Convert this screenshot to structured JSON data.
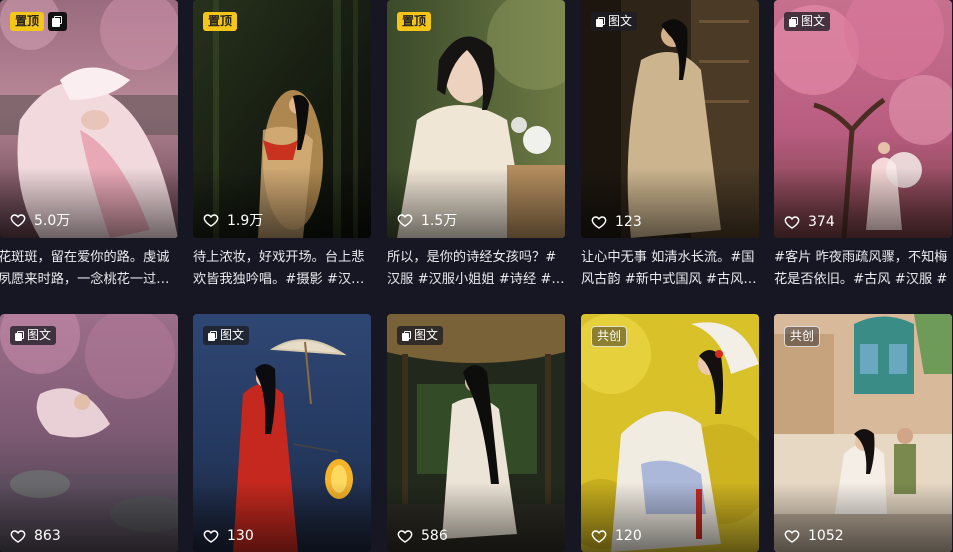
{
  "cards": [
    {
      "badge": "置顶",
      "badge_type": "pin",
      "extra_icon": "gallery-icon",
      "likes": "5.0万",
      "title_l1": "花斑斑，留在爱你的路。虔诚",
      "title_l2": "夙愿来时路，一念桃花一过…"
    },
    {
      "badge": "置顶",
      "badge_type": "pin",
      "likes": "1.9万",
      "title_l1": "待上浓妆，好戏开场。台上悲",
      "title_l2": "欢皆我独吟唱。#摄影 #汉…"
    },
    {
      "badge": "置顶",
      "badge_type": "pin",
      "likes": "1.5万",
      "title_l1": "所以，是你的诗经女孩吗？#",
      "title_l2": "汉服 #汉服小姐姐 #诗经 #…"
    },
    {
      "badge": "图文",
      "badge_type": "dark",
      "likes": "123",
      "title_l1": "让心中无事 如清水长流。#国",
      "title_l2": "风古韵 #新中式国风 #古风…"
    },
    {
      "badge": "图文",
      "badge_type": "dark",
      "likes": "374",
      "title_l1": "#客片 昨夜雨疏风骤，不知梅",
      "title_l2": "花是否依旧。#古风 #汉服 #"
    },
    {
      "badge": "图文",
      "badge_type": "dark",
      "likes": "863"
    },
    {
      "badge": "图文",
      "badge_type": "dark",
      "likes": "130"
    },
    {
      "badge": "图文",
      "badge_type": "dark",
      "likes": "586"
    },
    {
      "badge": "共创",
      "badge_type": "outline",
      "likes": "120"
    },
    {
      "badge": "共创",
      "badge_type": "outline",
      "likes": "1052"
    }
  ],
  "colors": {
    "background": "#161722",
    "pin_badge": "#f5c518"
  }
}
